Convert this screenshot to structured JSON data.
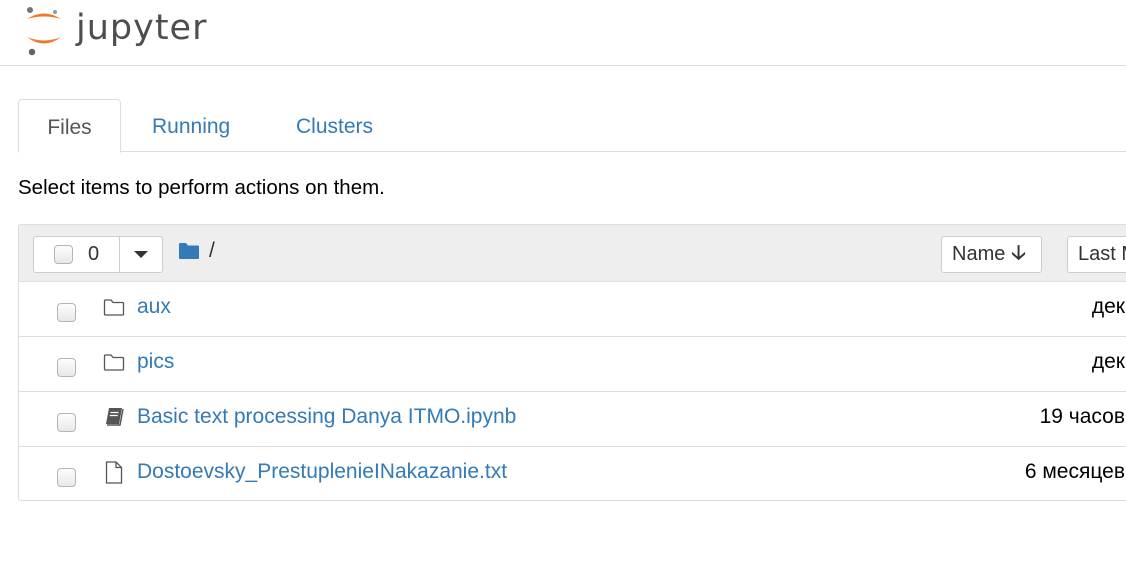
{
  "header": {
    "logo_text": "jupyter"
  },
  "tabs": [
    {
      "label": "Files",
      "active": true
    },
    {
      "label": "Running",
      "active": false
    },
    {
      "label": "Clusters",
      "active": false
    }
  ],
  "hint": "Select items to perform actions on them.",
  "toolbar": {
    "selected_count": "0",
    "breadcrumb_sep": "/",
    "sort_name_label": "Name",
    "sort_last_label": "Last M"
  },
  "items": [
    {
      "type": "folder",
      "icon": "folder-outline-icon",
      "name": "aux",
      "time": "дек"
    },
    {
      "type": "folder",
      "icon": "folder-outline-icon",
      "name": "pics",
      "time": "дек"
    },
    {
      "type": "notebook",
      "icon": "notebook-icon",
      "name": "Basic text processing Danya ITMO.ipynb",
      "time": "19 часов"
    },
    {
      "type": "file",
      "icon": "file-icon",
      "name": "Dostoevsky_PrestuplenieINakazanie.txt",
      "time": "6 месяцев"
    }
  ],
  "colors": {
    "link": "#337ab7",
    "logo_orange": "#f37726",
    "folder_blue": "#337ab7"
  }
}
